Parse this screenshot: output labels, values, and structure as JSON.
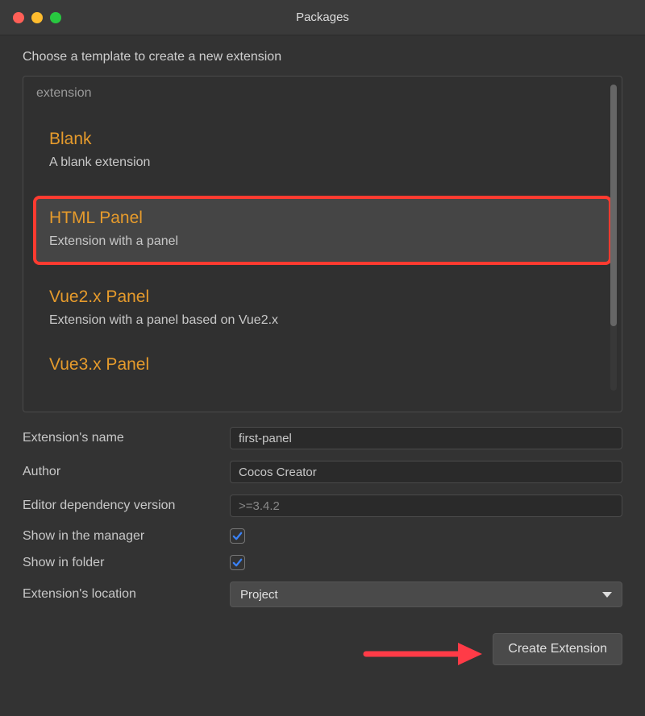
{
  "window": {
    "title": "Packages"
  },
  "prompt": "Choose a template to create a new extension",
  "panel": {
    "header": "extension",
    "items": [
      {
        "title": "Blank",
        "desc": "A blank extension",
        "selected": false,
        "highlighted": false
      },
      {
        "title": "HTML Panel",
        "desc": "Extension with a panel",
        "selected": true,
        "highlighted": true
      },
      {
        "title": "Vue2.x Panel",
        "desc": "Extension with a panel based on Vue2.x",
        "selected": false,
        "highlighted": false
      }
    ],
    "peek_title": "Vue3.x Panel"
  },
  "form": {
    "name_label": "Extension's name",
    "name_value": "first-panel",
    "author_label": "Author",
    "author_value": "Cocos Creator",
    "editor_version_label": "Editor dependency version",
    "editor_version_placeholder": ">=3.4.2",
    "show_manager_label": "Show in the manager",
    "show_manager_checked": true,
    "show_folder_label": "Show in folder",
    "show_folder_checked": true,
    "location_label": "Extension's location",
    "location_value": "Project"
  },
  "footer": {
    "create_button": "Create Extension"
  },
  "colors": {
    "accent": "#e69b2c",
    "highlight": "#ff3b30",
    "check": "#3a82f7"
  }
}
